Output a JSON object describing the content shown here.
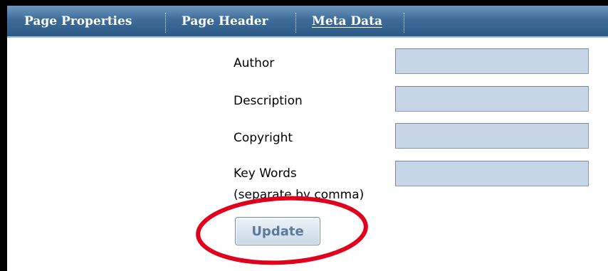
{
  "tabs": [
    {
      "label": "Page Properties",
      "active": false
    },
    {
      "label": "Page Header",
      "active": false
    },
    {
      "label": "Meta Data",
      "active": true
    }
  ],
  "form": {
    "author": {
      "label": "Author",
      "value": ""
    },
    "description": {
      "label": "Description",
      "value": ""
    },
    "copyright": {
      "label": "Copyright",
      "value": ""
    },
    "keywords": {
      "label": "Key Words",
      "hint": "(separate by comma)",
      "value": ""
    }
  },
  "actions": {
    "update_label": "Update"
  },
  "colors": {
    "tabbar": "#3f6c99",
    "input_bg": "#c6d6e6",
    "callout": "#e0001b"
  }
}
